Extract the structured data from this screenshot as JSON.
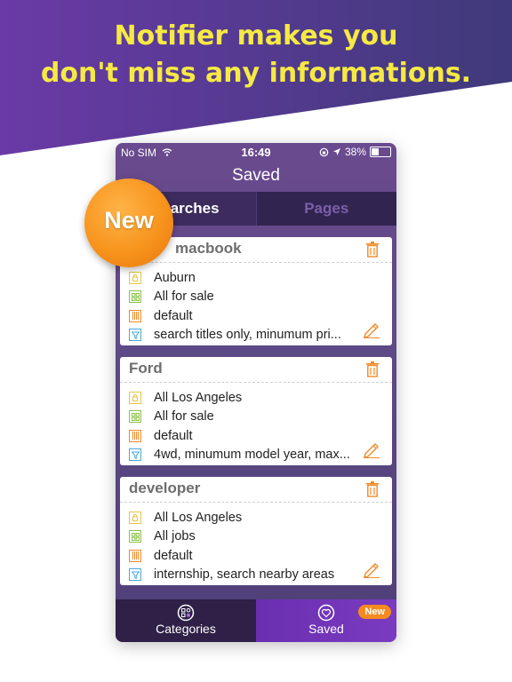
{
  "headline": {
    "line1": "Notifier makes you",
    "line2": "don't miss any informations."
  },
  "status_bar": {
    "carrier": "No SIM",
    "time": "16:49",
    "battery": "38%",
    "battery_level": 0.38
  },
  "nav": {
    "title": "Saved"
  },
  "segments": [
    {
      "label": "Searches"
    },
    {
      "label": "Pages"
    }
  ],
  "new_badge": {
    "label": "New"
  },
  "cards": [
    {
      "title": "macbook",
      "rows": [
        {
          "icon": "location-icon",
          "text": "Auburn"
        },
        {
          "icon": "category-icon",
          "text": "All for sale"
        },
        {
          "icon": "source-icon",
          "text": "default"
        },
        {
          "icon": "filter-icon",
          "text": "search titles only, minumum pri..."
        }
      ]
    },
    {
      "title": "Ford",
      "rows": [
        {
          "icon": "location-icon",
          "text": "All Los Angeles"
        },
        {
          "icon": "category-icon",
          "text": "All for sale"
        },
        {
          "icon": "source-icon",
          "text": "default"
        },
        {
          "icon": "filter-icon",
          "text": "4wd, minumum model year, max..."
        }
      ]
    },
    {
      "title": "developer",
      "rows": [
        {
          "icon": "location-icon",
          "text": "All Los Angeles"
        },
        {
          "icon": "category-icon",
          "text": "All jobs"
        },
        {
          "icon": "source-icon",
          "text": "default"
        },
        {
          "icon": "filter-icon",
          "text": "internship, search nearby areas"
        }
      ]
    }
  ],
  "tabbar": {
    "categories_label": "Categories",
    "saved_label": "Saved",
    "saved_badge": "New"
  },
  "colors": {
    "headline_text": "#f5ea43",
    "accent_orange": "#f58a1f",
    "purple_dark": "#2e2046",
    "purple_active": "#7a3bc0"
  }
}
